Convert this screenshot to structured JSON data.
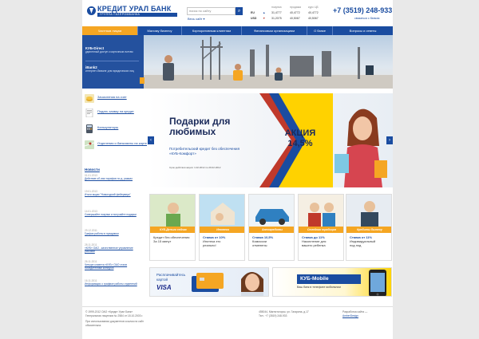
{
  "header": {
    "logo_name": "КРЕДИТ УРАЛ БАНК",
    "logo_sub": "ГРУППА ГАЗПРОМБАНКА",
    "search_placeholder": "поиск по сайту",
    "search_scope": "Весь сайт ▾",
    "phone": "+7 (3519) 248-933",
    "contact_link": "связаться с банком"
  },
  "rates": {
    "headers": [
      "покупка",
      "продажа",
      "курс ЦБ"
    ],
    "rows": [
      {
        "currency": "EU",
        "buy": "31,4777",
        "sell": "40,4772",
        "cb": "40,4772"
      },
      {
        "currency": "USD",
        "buy": "31,2075",
        "sell": "40,5067",
        "cb": "40,5067"
      }
    ]
  },
  "nav": [
    "Частным лицам",
    "Малому бизнесу",
    "Корпоративным клиентам",
    "Финансовым организациям",
    "О банке",
    "Вопросы и ответы"
  ],
  "hero_panel": [
    {
      "title": "КУБ-Direct",
      "desc": "удаленный доступ к карточным счетам"
    },
    {
      "title": "iBank2",
      "desc": "интернет-банкинг для юридических лиц"
    }
  ],
  "sidebar_links": [
    {
      "label": "Зачисления на счет",
      "icon": "coins-icon"
    },
    {
      "label": "Подать заявку на кредит",
      "icon": "application-icon"
    },
    {
      "label": "Калькуляторы",
      "icon": "calculator-icon"
    },
    {
      "label": "Отделения и банкоматы на карте",
      "icon": "map-icon"
    }
  ],
  "news": {
    "heading": "Новости",
    "items": [
      {
        "date": "01.01.2013",
        "text": "Действие об изм тарифов по д. рамках"
      },
      {
        "date": "19.01.2013",
        "text": "Итоги акции \"Новогодний фейерверк\""
      },
      {
        "date": "14.01.2013",
        "text": "Совершайте покупки и получайте подарки"
      },
      {
        "date": "29.12.2011",
        "text": "График работы в праздники"
      },
      {
        "date": "28.11.2011",
        "text": "«КУБ» ОАО - качественное управление рисками"
      },
      {
        "date": "26.11.2011",
        "text": "Четыре клиента «КУБ» ОАО стали победителями конкурса"
      },
      {
        "date": "16.11.2011",
        "text": "Информация о графике работы отделений"
      }
    ]
  },
  "promo": {
    "title": "Подарки для любимых",
    "desc": "Потребительский кредит без обеспечения «КУБ-Комфорт»",
    "terms": "Срок действия акции: 1.02.2012 по 29.02.2012",
    "akcia_label": "АКЦИЯ",
    "akcia_value": "14,5%",
    "prev": "‹",
    "next": "›"
  },
  "cards": [
    {
      "band": "КУБ-Деньги сейчас",
      "band_color": "#f5a623",
      "line1": "Кредит без обеспечения",
      "line2": "За 15 минут",
      "bold": ""
    },
    {
      "band": "Ипотека",
      "band_color": "#f5a623",
      "bold": "Ставка от 10%",
      "line1": "Ипотека это",
      "line2": "реально!"
    },
    {
      "band": "Автокредиты",
      "band_color": "#f5a623",
      "bold": "Ставка 10,5%",
      "line1": "Комиссии",
      "line2": "отменены"
    },
    {
      "band": "Семейная традиция",
      "band_color": "#f5a623",
      "bold": "Ставка до 11%",
      "line1": "Накопление для",
      "line2": "вашего ребенка"
    },
    {
      "band": "Кредиты бизнесу",
      "band_color": "#f5a623",
      "bold": "Ставка от 11%",
      "line1": "Индивидуальный",
      "line2": "под под"
    }
  ],
  "banners": {
    "visa": {
      "line1": "Расплачивайтесь",
      "line2": "картой",
      "brand": "VISA"
    },
    "mobile": {
      "title": "КУБ-Mobile",
      "sub": "Ваш банк в телефоне мобильном"
    }
  },
  "footer": {
    "copyright": "© 1999-2012 ОАО «Кредит Урал Банк»",
    "license": "Генеральная лицензия № 2584 от 18.10.2003 г.",
    "note1": "При использовании документов ссылка на сайт",
    "note2": "обязательна.",
    "address": "455044, Магнитогорск, ул. Гагарина, д.17",
    "tel": "Тел.: +7 (3519) 248-933",
    "dev": "Разработка сайта —",
    "dev_link": "AmberDesign"
  },
  "colors": {
    "brand_blue": "#1a4ca0",
    "accent_orange": "#f5a623"
  }
}
